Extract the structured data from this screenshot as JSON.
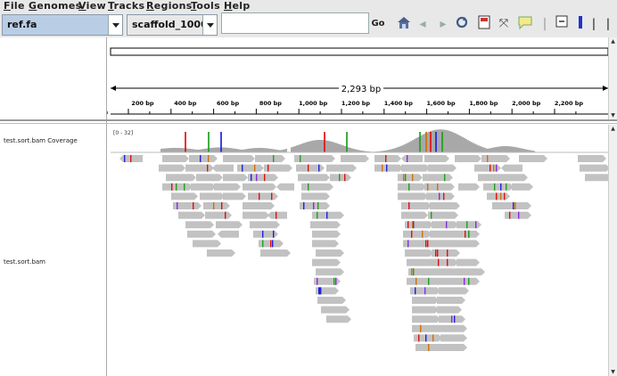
{
  "menu": [
    "File",
    "Genomes",
    "View",
    "Tracks",
    "Regions",
    "Tools",
    "Help"
  ],
  "toolbar": {
    "genome": "ref.fa",
    "chromosome": "scaffold_1000",
    "locus": "",
    "go_label": "Go"
  },
  "ruler": {
    "span_label": "2,293 bp",
    "ticks": [
      "200 bp",
      "400 bp",
      "600 bp",
      "800 bp",
      "1,000 bp",
      "1,200 bp",
      "1,400 bp",
      "1,600 bp",
      "1,800 bp",
      "2,000 bp",
      "2,200 bp"
    ]
  },
  "tracks": {
    "coverage_name": "test.sort.bam Coverage",
    "coverage_range": "[0 - 32]",
    "alignment_name": "test.sort.bam"
  },
  "colors": {
    "read": "#c2c2c2",
    "coverage": "#a8a8a8",
    "mismatch_A": "#1ea01e",
    "mismatch_C": "#2020e0",
    "mismatch_G": "#d17105",
    "mismatch_T": "#e01010",
    "insertion": "#8a2be2"
  },
  "icons": [
    "home-icon",
    "back-icon",
    "forward-icon",
    "refresh-icon",
    "roi-icon",
    "resize-icon",
    "popup-icon",
    "detail-collapse-icon",
    "detail-blue-icon",
    "detail-line-icon"
  ]
}
